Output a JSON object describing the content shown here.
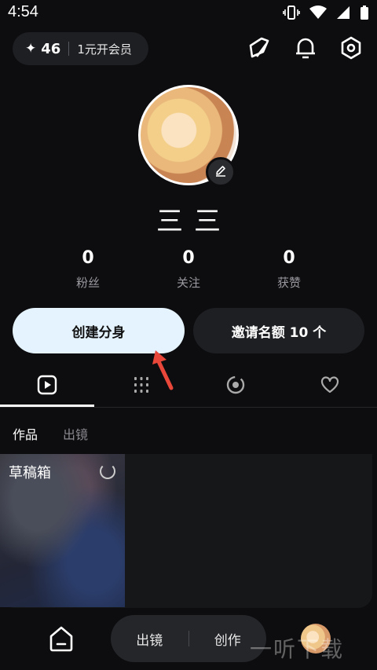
{
  "status_bar": {
    "time": "4:54"
  },
  "top_bar": {
    "points": "46",
    "member_label": "1元开会员"
  },
  "profile": {
    "username": "三三"
  },
  "stats": [
    {
      "value": "0",
      "label": "粉丝"
    },
    {
      "value": "0",
      "label": "关注"
    },
    {
      "value": "0",
      "label": "获赞"
    }
  ],
  "actions": {
    "create_label": "创建分身",
    "invite_label": "邀请名额 10 个"
  },
  "sub_tabs": {
    "works": "作品",
    "appear": "出镜"
  },
  "draft": {
    "label": "草稿箱"
  },
  "bottom_nav": {
    "appear": "出镜",
    "create": "创作"
  },
  "watermark": "一听下载",
  "colors": {
    "accent_button": "#e4f3fd",
    "arrow": "#e8473a"
  }
}
